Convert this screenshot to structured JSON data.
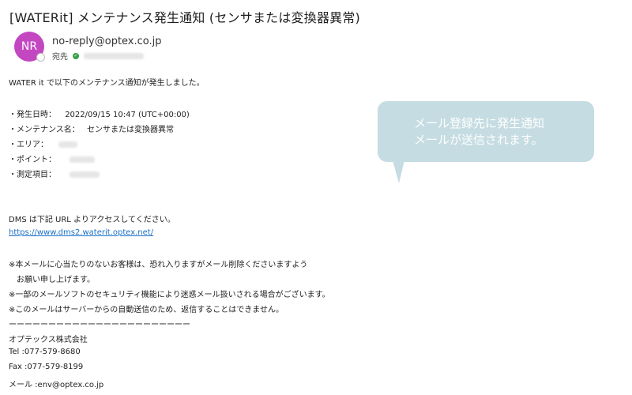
{
  "email": {
    "subject": "[WATERit] メンテナンス発生通知 (センサまたは変換器異常)",
    "avatar_initials": "NR",
    "avatar_color": "#c347c1",
    "from": "no-reply@optex.co.jp",
    "to_label": "宛先",
    "intro": "WATER it で以下のメンテナンス通知が発生しました。",
    "details": {
      "occurred_label": "・発生日時：",
      "occurred_value": "2022/09/15 10:47 (UTC+00:00)",
      "maintenance_label": "・メンテナンス名：",
      "maintenance_value": "センサまたは変換器異常",
      "area_label": "・エリア：",
      "point_label": "・ポイント：",
      "measure_label": "・測定項目："
    },
    "access_text": "DMS は下記 URL よりアクセスしてください。",
    "url": "https://www.dms2.waterit.optex.net/",
    "notes": [
      "※本メールに心当たりのないお客様は、恐れ入りますがメール削除くださいますよう",
      "　お願い申し上げます。",
      "※一部のメールソフトのセキュリティ機能により迷惑メール扱いされる場合がございます。",
      "※このメールはサーバーからの自動送信のため、返信することはできません。"
    ],
    "separator": "ーーーーーーーーーーーーーーーーーーーーーーー",
    "signature": {
      "company": "オプテックス株式会社",
      "tel": "Tel :077-579-8680",
      "fax": "Fax :077-579-8199",
      "mail": "メール :env@optex.co.jp"
    }
  },
  "callout": {
    "line1": "メール登録先に発生通知",
    "line2": "メールが送信されます。",
    "color": "#c5dce2"
  }
}
